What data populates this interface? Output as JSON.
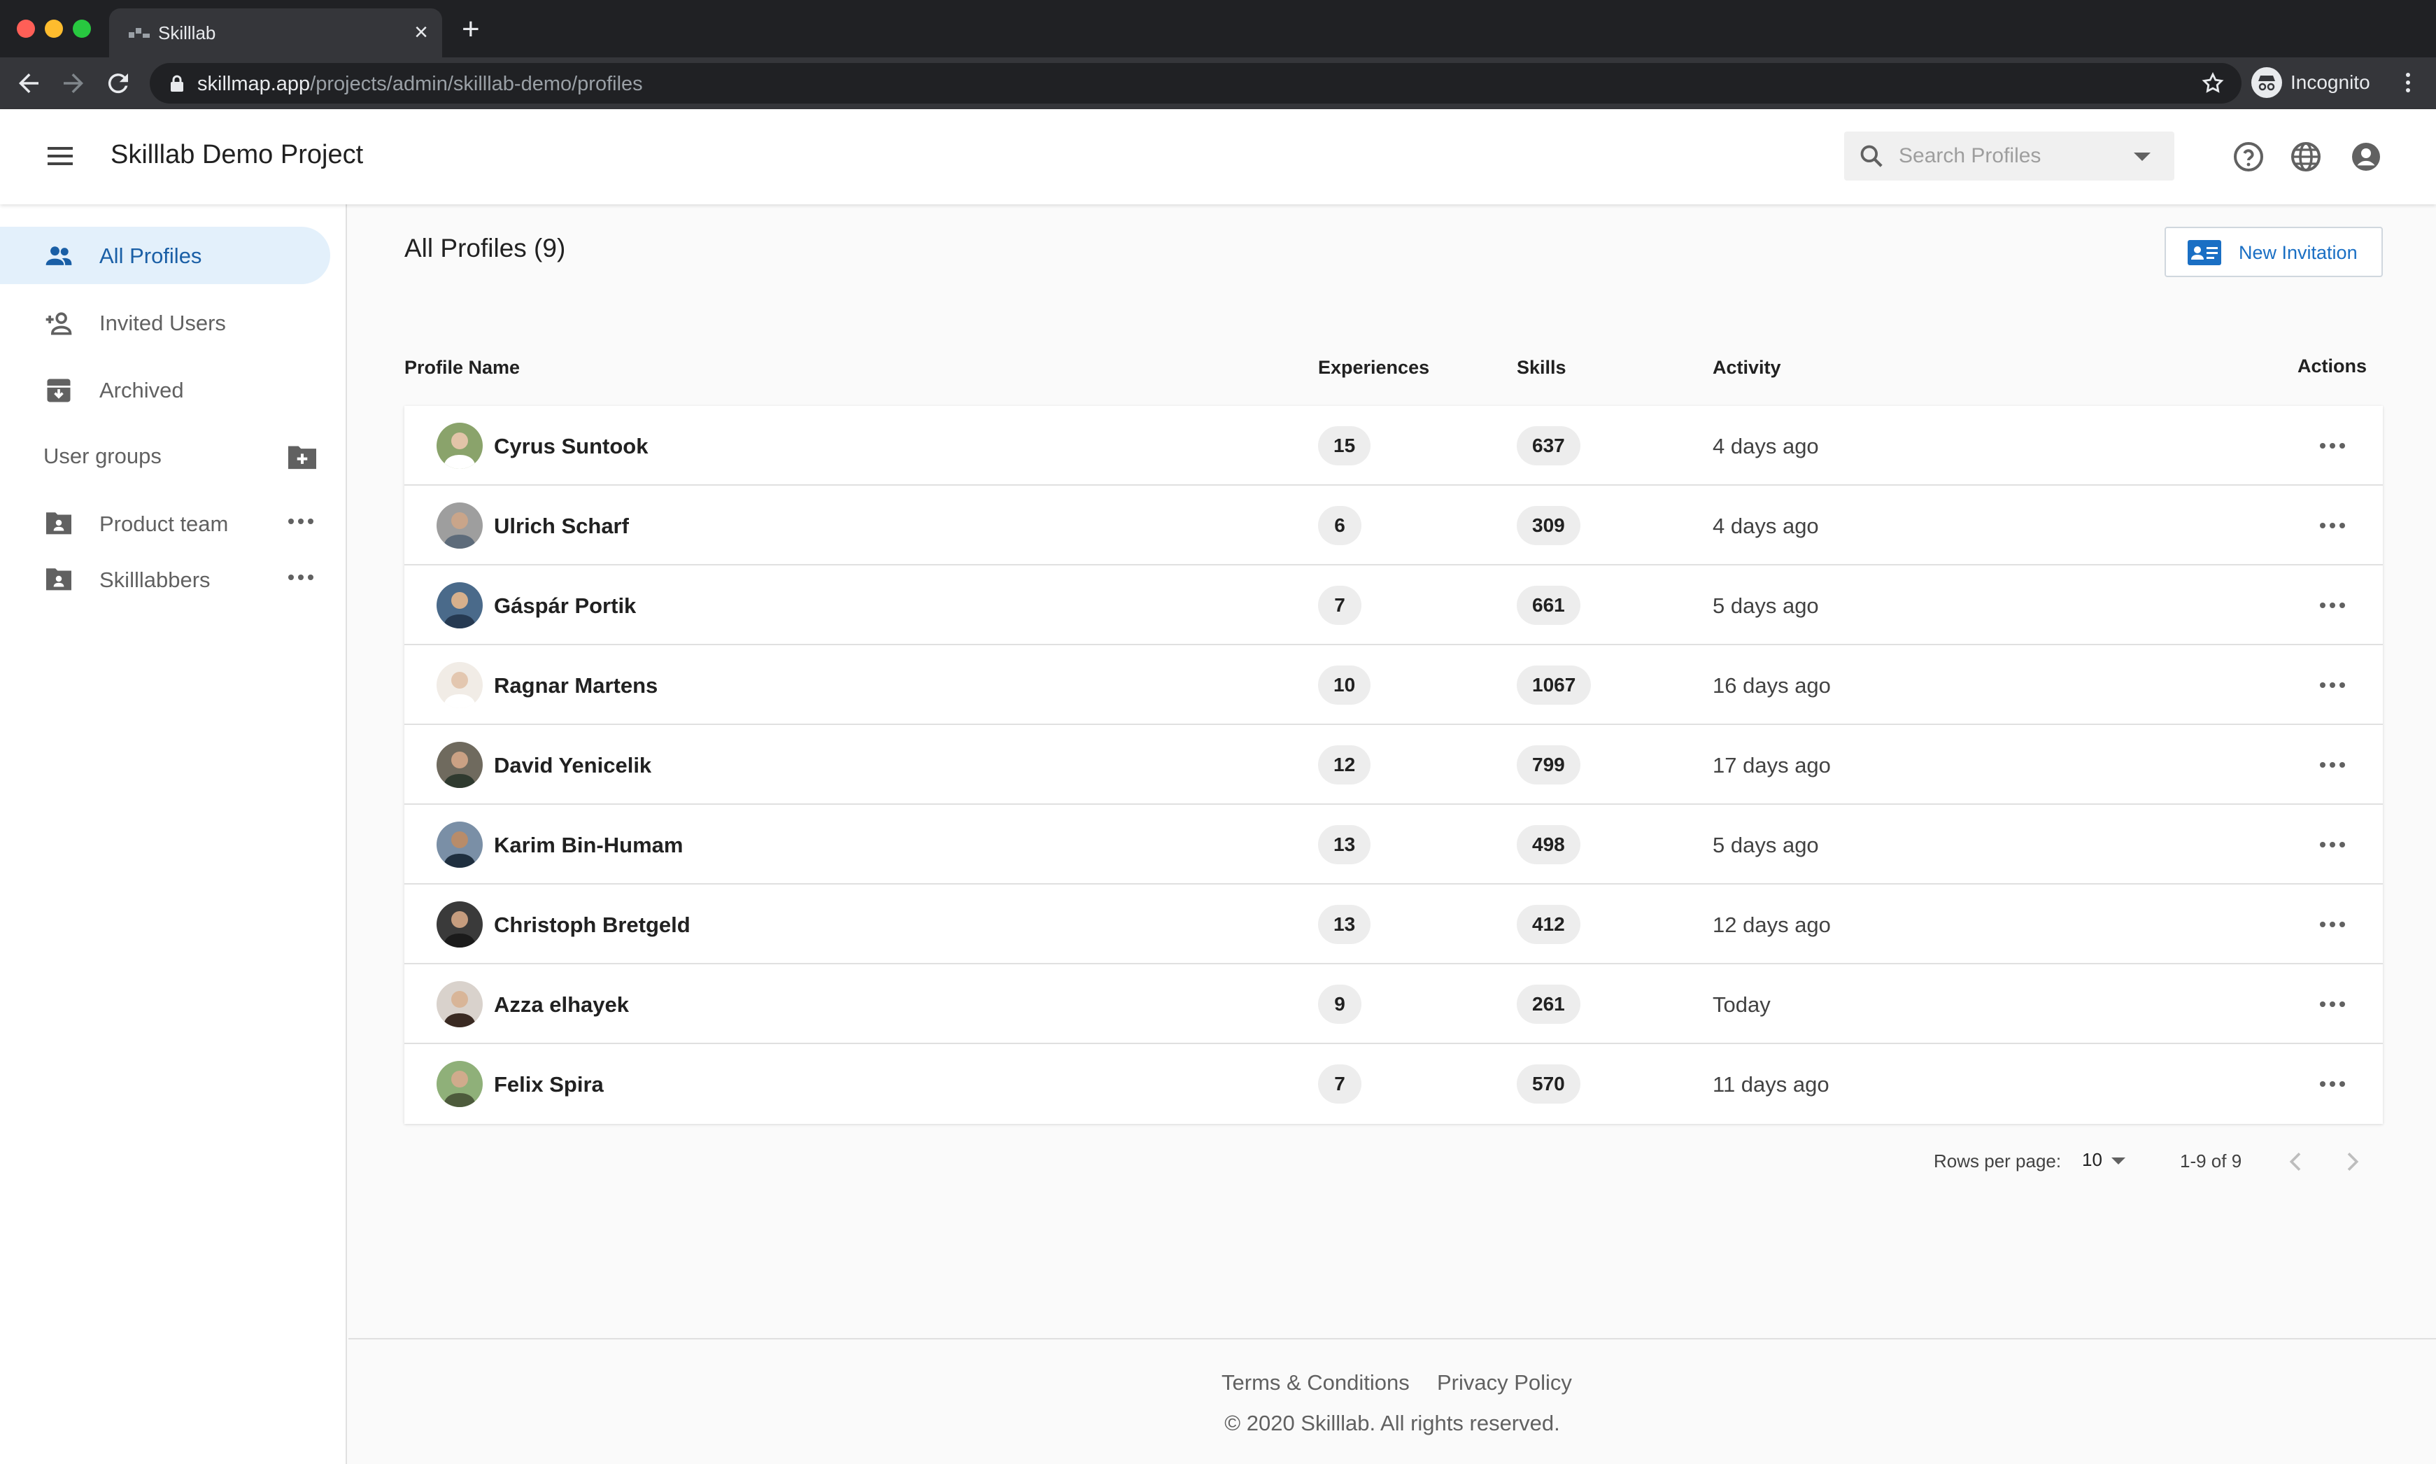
{
  "browser": {
    "tab_title": "Skilllab",
    "url_host": "skillmap.app",
    "url_path": "/projects/admin/skilllab-demo/profiles",
    "profile_label": "Incognito"
  },
  "header": {
    "title": "Skilllab Demo Project",
    "search_placeholder": "Search Profiles",
    "icons": [
      "help-icon",
      "globe-icon",
      "account-icon"
    ]
  },
  "sidebar": {
    "items": [
      {
        "label": "All Profiles",
        "icon": "people-icon",
        "active": true
      },
      {
        "label": "Invited Users",
        "icon": "person-add-icon",
        "active": false
      },
      {
        "label": "Archived",
        "icon": "archive-icon",
        "active": false
      }
    ],
    "groups_title": "User groups",
    "groups": [
      {
        "label": "Product team"
      },
      {
        "label": "Skilllabbers"
      }
    ]
  },
  "main": {
    "title": "All Profiles (9)",
    "new_invitation_label": "New Invitation",
    "columns": {
      "name": "Profile Name",
      "experiences": "Experiences",
      "skills": "Skills",
      "activity": "Activity",
      "actions": "Actions"
    },
    "rows": [
      {
        "name": "Cyrus Suntook",
        "experiences": "15",
        "skills": "637",
        "activity": "4 days ago"
      },
      {
        "name": "Ulrich Scharf",
        "experiences": "6",
        "skills": "309",
        "activity": "4 days ago"
      },
      {
        "name": "Gáspár Portik",
        "experiences": "7",
        "skills": "661",
        "activity": "5 days ago"
      },
      {
        "name": "Ragnar Martens",
        "experiences": "10",
        "skills": "1067",
        "activity": "16 days ago"
      },
      {
        "name": "David Yenicelik",
        "experiences": "12",
        "skills": "799",
        "activity": "17 days ago"
      },
      {
        "name": "Karim Bin-Humam",
        "experiences": "13",
        "skills": "498",
        "activity": "5 days ago"
      },
      {
        "name": "Christoph Bretgeld",
        "experiences": "13",
        "skills": "412",
        "activity": "12 days ago"
      },
      {
        "name": "Azza elhayek",
        "experiences": "9",
        "skills": "261",
        "activity": "Today"
      },
      {
        "name": "Felix Spira",
        "experiences": "7",
        "skills": "570",
        "activity": "11 days ago"
      }
    ],
    "pagination": {
      "rows_per_page_label": "Rows per page:",
      "rows_per_page": "10",
      "range": "1-9 of 9"
    }
  },
  "footer": {
    "terms": "Terms & Conditions",
    "privacy": "Privacy Policy",
    "copyright": "© 2020 Skilllab. All rights reserved."
  },
  "colors": {
    "accent": "#1a6fc4",
    "active_nav_bg": "#e3f0fb",
    "active_nav_text": "#1a5fa6"
  }
}
